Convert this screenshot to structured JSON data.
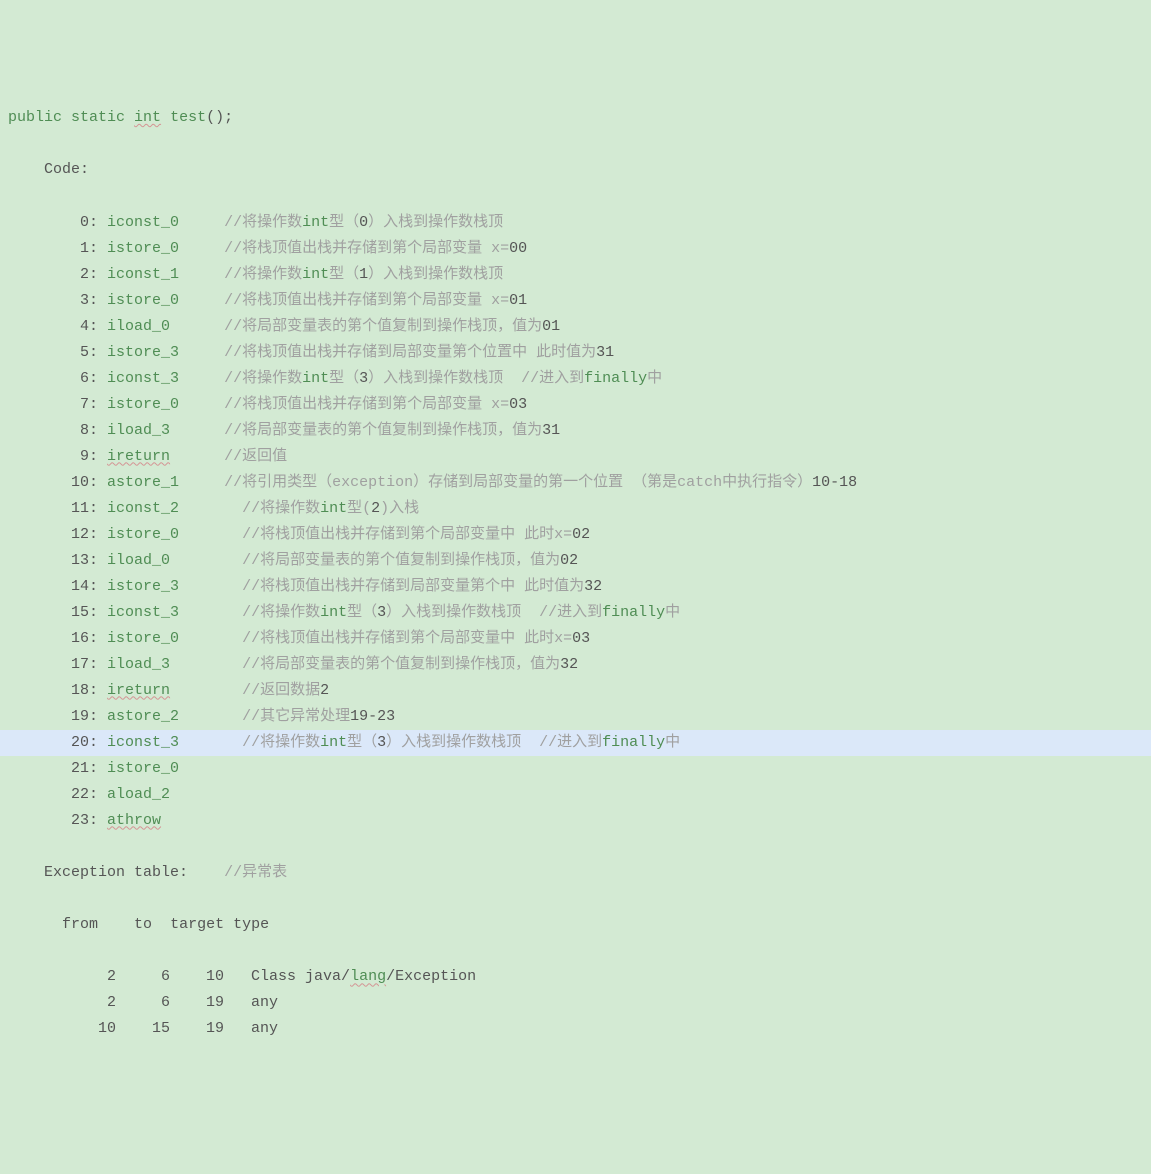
{
  "signature": {
    "modifiers": "public static",
    "rettype": "int",
    "name": "test",
    "after": "();"
  },
  "code_label": "Code:",
  "lines": [
    {
      "idx": "0",
      "op": "iconst_0",
      "c": "//将操作数",
      "ck": "int",
      "c2": "型（",
      "cn": "0",
      "c3": "）入栈到操作数栈顶"
    },
    {
      "idx": "1",
      "op": "istore_0",
      "c": "//将栈顶值出栈并存储到第",
      "cn": "0",
      "c2": "个局部变量 x=",
      "cn2": "0"
    },
    {
      "idx": "2",
      "op": "iconst_1",
      "c": "//将操作数",
      "ck": "int",
      "c2": "型（",
      "cn": "1",
      "c3": "）入栈到操作数栈顶"
    },
    {
      "idx": "3",
      "op": "istore_0",
      "c": "//将栈顶值出栈并存储到第",
      "cn": "0",
      "c2": "个局部变量 x=",
      "cn2": "1"
    },
    {
      "idx": "4",
      "op": "iload_0",
      "c": "//将局部变量表的第",
      "cn": "0",
      "c2": "个值复制到操作栈顶，值为",
      "cn2": "1"
    },
    {
      "idx": "5",
      "op": "istore_3",
      "c": "//将栈顶值出栈并存储到局部变量第",
      "cn": "3",
      "c2": "个位置中 此时值为",
      "cn2": "1"
    },
    {
      "idx": "6",
      "op": "iconst_3",
      "c": "//将操作数",
      "ck": "int",
      "c2": "型（",
      "cn": "3",
      "c3": "）入栈到操作数栈顶  //进入到",
      "ck2": "finally",
      "c4": "中"
    },
    {
      "idx": "7",
      "op": "istore_0",
      "c": "//将栈顶值出栈并存储到第",
      "cn": "0",
      "c2": "个局部变量 x=",
      "cn2": "3"
    },
    {
      "idx": "8",
      "op": "iload_3",
      "c": "//将局部变量表的第",
      "cn": "3",
      "c2": "个值复制到操作栈顶，值为",
      "cn2": "1"
    },
    {
      "idx": "9",
      "op": "ireturn",
      "sq": true,
      "c": "//返回值"
    },
    {
      "idx": "10",
      "op": "astore_1",
      "c": "//将引用类型（exception）存储到局部变量的第一个位置 （第",
      "cn": "10-18",
      "c2": "是catch中执行指令）"
    },
    {
      "idx": "11",
      "op": "iconst_2",
      "pad": "  ",
      "c": "//将操作数",
      "ck": "int",
      "c2": "型(",
      "cn": "2",
      "c3": ")入栈"
    },
    {
      "idx": "12",
      "op": "istore_0",
      "pad": "  ",
      "c": "//将栈顶值出栈并存储到第",
      "cn": "0",
      "c2": "个局部变量中 此时x=",
      "cn2": "2"
    },
    {
      "idx": "13",
      "op": "iload_0",
      "pad": "  ",
      "c": "//将局部变量表的第",
      "cn": "0",
      "c2": "个值复制到操作栈顶，值为",
      "cn2": "2"
    },
    {
      "idx": "14",
      "op": "istore_3",
      "pad": "  ",
      "c": "//将栈顶值出栈并存储到局部变量第",
      "cn": "3",
      "c2": "个中 此时值为",
      "cn2": "2"
    },
    {
      "idx": "15",
      "op": "iconst_3",
      "pad": "  ",
      "c": "//将操作数",
      "ck": "int",
      "c2": "型（",
      "cn": "3",
      "c3": "）入栈到操作数栈顶  //进入到",
      "ck2": "finally",
      "c4": "中"
    },
    {
      "idx": "16",
      "op": "istore_0",
      "pad": "  ",
      "c": "//将栈顶值出栈并存储到第",
      "cn": "0",
      "c2": "个局部变量中 此时x=",
      "cn2": "3"
    },
    {
      "idx": "17",
      "op": "iload_3",
      "pad": "  ",
      "c": "//将局部变量表的第",
      "cn": "3",
      "c2": "个值复制到操作栈顶，值为",
      "cn2": "2"
    },
    {
      "idx": "18",
      "op": "ireturn",
      "sq": true,
      "pad": "  ",
      "c": "//返回数据",
      "cn": "2"
    },
    {
      "idx": "19",
      "op": "astore_2",
      "pad": "  ",
      "c": "//",
      "cn": "19-23",
      "c2": "其它异常处理"
    },
    {
      "idx": "20",
      "op": "iconst_3",
      "pad": "  ",
      "hl": true,
      "c": "//将操作数",
      "ck": "int",
      "c2": "型（",
      "cn": "3",
      "c3": "）入栈到操作数栈顶  //进入到",
      "ck2": "finally",
      "c4": "中"
    },
    {
      "idx": "21",
      "op": "istore_0"
    },
    {
      "idx": "22",
      "op": "aload_2"
    },
    {
      "idx": "23",
      "op": "athrow",
      "sq": true
    }
  ],
  "exception_table": {
    "label": "Exception table:",
    "comment": "//异常表",
    "header": {
      "from": "from",
      "to": "to",
      "target": "target",
      "type": "type"
    },
    "rows": [
      {
        "from": "2",
        "to": "6",
        "target": "10",
        "type_pre": "Class java/",
        "type_sq": "lang",
        "type_post": "/Exception"
      },
      {
        "from": "2",
        "to": "6",
        "target": "19",
        "type": "any"
      },
      {
        "from": "10",
        "to": "15",
        "target": "19",
        "type": "any"
      }
    ]
  }
}
